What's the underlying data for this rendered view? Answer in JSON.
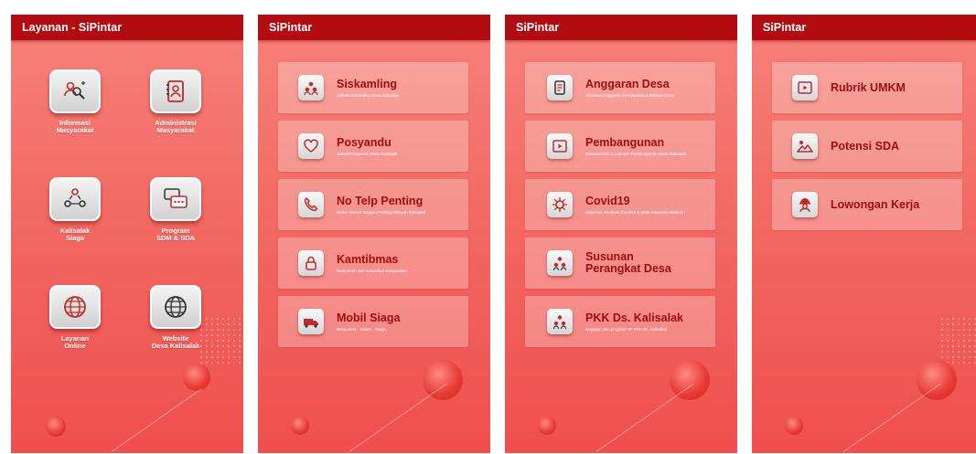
{
  "colors": {
    "header": "#b30c10",
    "title_text": "#a00d12",
    "bg_top": "#f6827a",
    "bg_bottom": "#ef4f4d"
  },
  "screen1": {
    "header": "Layanan - SiPintar",
    "items": [
      {
        "label": "Informasi\nMasyarakat",
        "icon": "people-search-icon"
      },
      {
        "label": "Administrasi\nMasyarakat",
        "icon": "address-book-icon"
      },
      {
        "label": "Kalisalak\nSiaga",
        "icon": "people-network-icon"
      },
      {
        "label": "Program\nSDM & SDA",
        "icon": "chat-bubbles-icon"
      },
      {
        "label": "Layanan\nOnline",
        "icon": "globe-icon"
      },
      {
        "label": "Website\nDesa Kalisalak",
        "icon": "globe-icon"
      }
    ]
  },
  "screen2": {
    "header": "SiPintar",
    "cards": [
      {
        "title": "Siskamling",
        "subtitle": "Jadwal Siskamling Desa Kalisalak",
        "icon": "guard-group-icon"
      },
      {
        "title": "Posyandu",
        "subtitle": "Jadwal Posyandu Desa Kalisalak",
        "icon": "heart-hand-icon"
      },
      {
        "title": "No Telp Penting",
        "subtitle": "Daftar Nomor Telepon Penting Wilayah Kalisalak",
        "icon": "phone-icon"
      },
      {
        "title": "Kamtibmas",
        "subtitle": "Keamanan dan Ketertiban Masyarakat",
        "icon": "lock-icon"
      },
      {
        "title": "Mobil Siaga",
        "subtitle": "Banyumas - Salam - Siaga",
        "icon": "truck-icon"
      }
    ]
  },
  "screen3": {
    "header": "SiPintar",
    "cards": [
      {
        "title": "Anggaran Desa",
        "subtitle": "Informasi Anggaran Pendapatan & Belanja Desa",
        "icon": "document-icon"
      },
      {
        "title": "Pembangunan",
        "subtitle": "Dokumentasi & Laporan Pembangunan Desa Kalisalak",
        "icon": "video-icon"
      },
      {
        "title": "Covid19",
        "subtitle": "Informasi Pandemi Covid19 & Data Penerima Bantuan",
        "icon": "virus-icon"
      },
      {
        "title": "Susunan\nPerangkat Desa",
        "subtitle": "",
        "icon": "org-chart-icon"
      },
      {
        "title": "PKK Ds. Kalisalak",
        "subtitle": "Kegiatan dan program TP PKK Ds. Kalisalak",
        "icon": "org-chart-icon"
      }
    ]
  },
  "screen4": {
    "header": "SiPintar",
    "cards": [
      {
        "title": "Rubrik UMKM",
        "icon": "video-icon"
      },
      {
        "title": "Potensi SDA",
        "icon": "landscape-icon"
      },
      {
        "title": "Lowongan Kerja",
        "icon": "worker-icon"
      }
    ]
  }
}
